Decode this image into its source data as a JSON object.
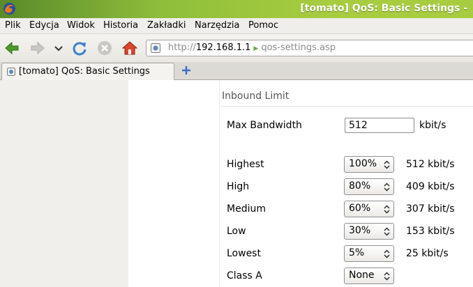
{
  "window": {
    "title": "[tomato] QoS: Basic Settings -"
  },
  "menu": {
    "items": [
      "Plik",
      "Edycja",
      "Widok",
      "Historia",
      "Zakładki",
      "Narzędzia",
      "Pomoc"
    ]
  },
  "url": {
    "protocol": "http://",
    "host": "192.168.1.1",
    "path": "qos-settings.asp"
  },
  "tabs": [
    {
      "label": "[tomato] QoS: Basic Settings",
      "active": true
    }
  ],
  "section": {
    "title": "Inbound Limit"
  },
  "max_bandwidth": {
    "label": "Max Bandwidth",
    "value": "512",
    "unit": "kbit/s"
  },
  "classes": [
    {
      "label": "Highest",
      "selected": "100%",
      "rate": "512 kbit/s"
    },
    {
      "label": "High",
      "selected": "80%",
      "rate": "409 kbit/s"
    },
    {
      "label": "Medium",
      "selected": "60%",
      "rate": "307 kbit/s"
    },
    {
      "label": "Low",
      "selected": "30%",
      "rate": "153 kbit/s"
    },
    {
      "label": "Lowest",
      "selected": "5%",
      "rate": "25 kbit/s"
    },
    {
      "label": "Class A",
      "selected": "None",
      "rate": ""
    }
  ],
  "icons": {
    "back": "back-arrow-icon",
    "forward": "forward-arrow-icon",
    "history": "chevron-down-icon",
    "reload": "reload-icon",
    "stop": "stop-icon",
    "home": "home-icon",
    "new_tab": "plus-icon"
  },
  "colors": {
    "titlebar": "#8fbf3a",
    "back_arrow": "#4c9a2a",
    "reload": "#3a7fcf",
    "home": "#d9452b"
  }
}
